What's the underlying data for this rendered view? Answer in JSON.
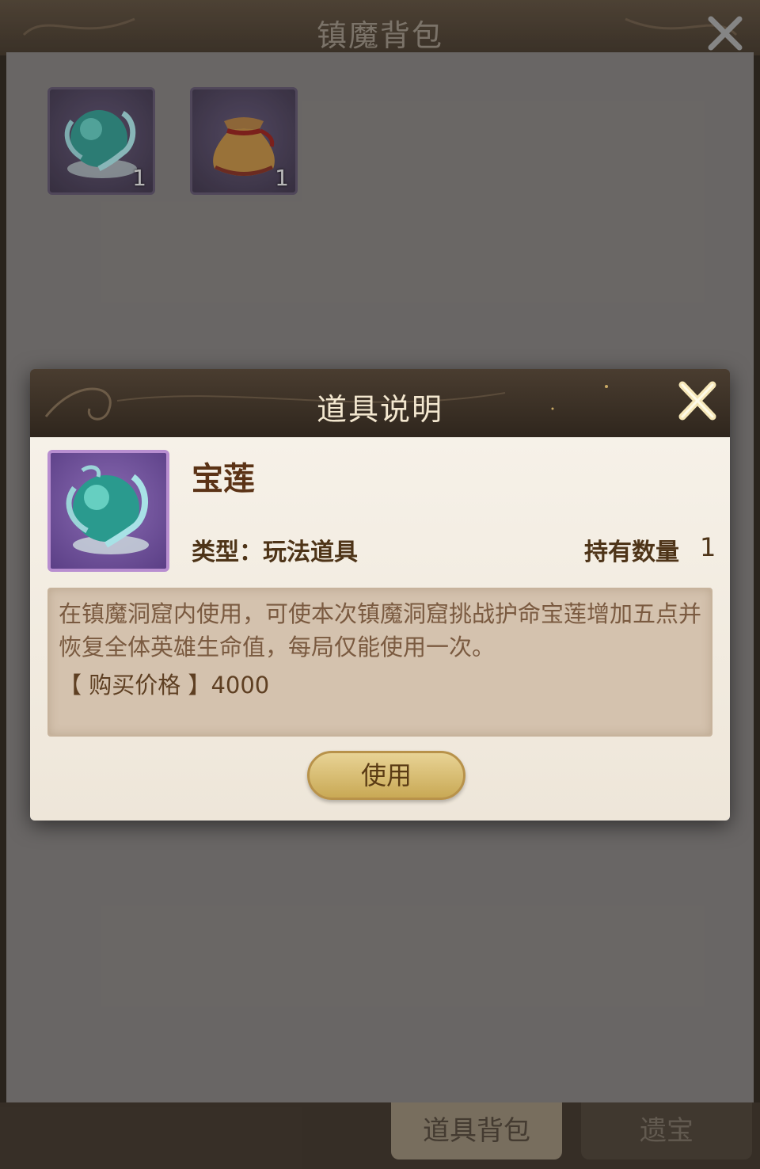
{
  "bag": {
    "title": "镇魔背包",
    "close_icon": "close-icon",
    "slots": [
      {
        "icon": "dragon-orb-icon",
        "count": "1"
      },
      {
        "icon": "treasure-pouch-icon",
        "count": "1"
      }
    ],
    "tabs": [
      {
        "label": "道具背包",
        "active": true
      },
      {
        "label": "遗宝",
        "active": false
      }
    ]
  },
  "dialog": {
    "title": "道具说明",
    "item_name": "宝莲",
    "item_type": "类型：玩法道具",
    "own_label": "持有数量",
    "own_value": "1",
    "description": "在镇魔洞窟内使用，可使本次镇魔洞窟挑战护命宝莲增加五点并恢复全体英雄生命值，每局仅能使用一次。",
    "price_label": "【 购买价格 】",
    "price_value": "4000",
    "use_button": "使用"
  },
  "colors": {
    "header_bg": "#3e3327",
    "panel_bg": "#787573",
    "dialog_bg": "#f6f1e8",
    "desc_bg": "#d4c2ae",
    "button_gold": "#c9a955",
    "title_text": "#f3e7cf",
    "item_frame_purple": "#b88ed0"
  }
}
